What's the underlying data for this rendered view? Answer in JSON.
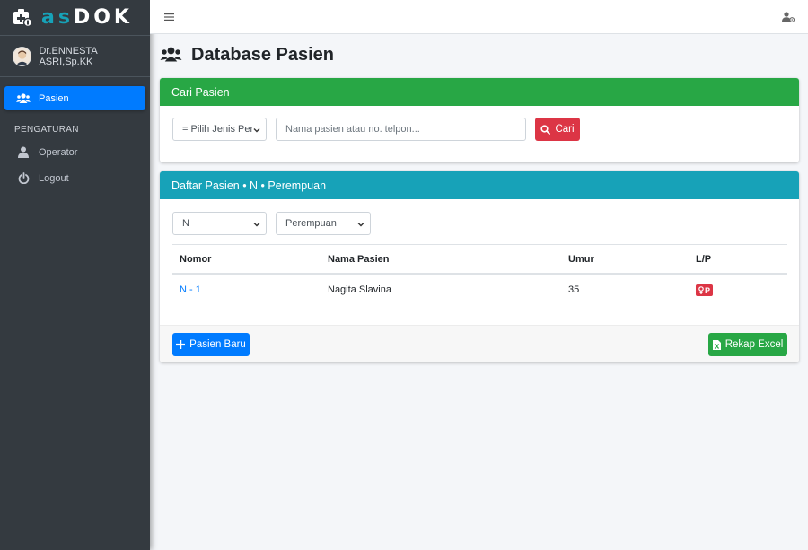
{
  "brand": {
    "prefix": "as",
    "suffix": "DOK"
  },
  "user": {
    "name": "Dr.ENNESTA ASRI,Sp.KK"
  },
  "sidebar": {
    "items": [
      {
        "label": "Pasien",
        "icon": "users-icon",
        "active": true
      }
    ],
    "section_header": "PENGATURAN",
    "settings": [
      {
        "label": "Operator",
        "icon": "user-icon"
      },
      {
        "label": "Logout",
        "icon": "power-icon"
      }
    ]
  },
  "page": {
    "title": "Database Pasien"
  },
  "search": {
    "header": "Cari Pasien",
    "type_select": "= Pilih Jenis Per",
    "input_placeholder": "Nama pasien atau no. telpon...",
    "button_label": "Cari"
  },
  "list": {
    "header": "Daftar Pasien • N • Perempuan",
    "filter_letter": "N",
    "filter_gender": "Perempuan",
    "columns": [
      "Nomor",
      "Nama Pasien",
      "Umur",
      "L/P"
    ],
    "rows": [
      {
        "nomor": "N - 1",
        "nama": "Nagita Slavina",
        "umur": "35",
        "lp": "P"
      }
    ]
  },
  "footer": {
    "new_button": "Pasien Baru",
    "excel_button": "Rekap Excel"
  },
  "colors": {
    "primary": "#007bff",
    "success": "#28a745",
    "info": "#17a2b8",
    "danger": "#dc3545",
    "sidebar": "#343a40"
  }
}
